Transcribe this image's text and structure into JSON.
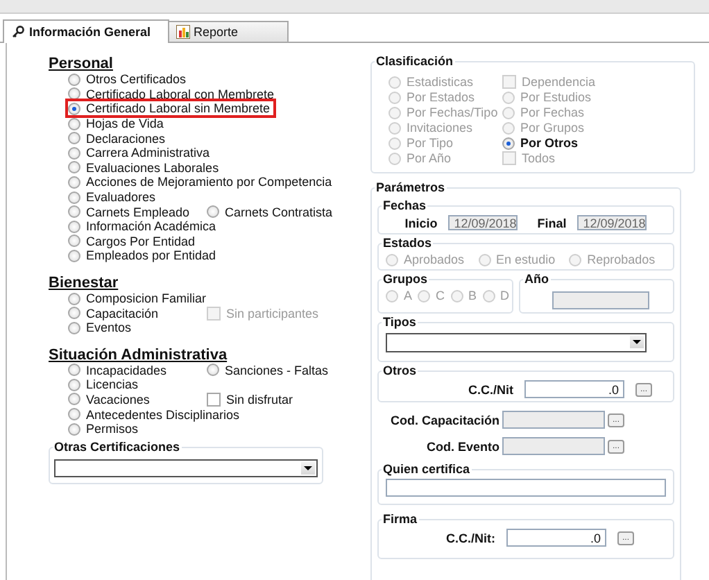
{
  "tabs": [
    {
      "label": "Información General",
      "selected": true,
      "kind": "gear"
    },
    {
      "label": "Reporte",
      "selected": false,
      "kind": "chart"
    }
  ],
  "left_sections": [
    {
      "title": "Personal",
      "rows": [
        [
          {
            "kind": "radio",
            "label": "Otros Certificados",
            "selected": false,
            "disabled": false,
            "highlighted": false
          }
        ],
        [
          {
            "kind": "radio",
            "label": "Certificado Laboral con Membrete",
            "selected": false,
            "disabled": false,
            "highlighted": false
          }
        ],
        [
          {
            "kind": "radio",
            "label": "Certificado Laboral sin Membrete",
            "selected": true,
            "disabled": false,
            "highlighted": true
          }
        ],
        [
          {
            "kind": "radio",
            "label": "Hojas de Vida",
            "selected": false,
            "disabled": false,
            "highlighted": false
          }
        ],
        [
          {
            "kind": "radio",
            "label": "Declaraciones",
            "selected": false,
            "disabled": false,
            "highlighted": false
          }
        ],
        [
          {
            "kind": "radio",
            "label": "Carrera Administrativa",
            "selected": false,
            "disabled": false,
            "highlighted": false
          }
        ],
        [
          {
            "kind": "radio",
            "label": "Evaluaciones Laborales",
            "selected": false,
            "disabled": false,
            "highlighted": false
          }
        ],
        [
          {
            "kind": "radio",
            "label": "Acciones de Mejoramiento por Competencia",
            "selected": false,
            "disabled": false,
            "highlighted": false
          }
        ],
        [
          {
            "kind": "radio",
            "label": "Evaluadores",
            "selected": false,
            "disabled": false,
            "highlighted": false
          }
        ],
        [
          {
            "kind": "radio",
            "label": "Carnets Empleado",
            "selected": false,
            "disabled": false,
            "highlighted": false
          },
          {
            "kind": "radio",
            "label": "Carnets Contratista",
            "selected": false,
            "disabled": false,
            "highlighted": false
          }
        ],
        [
          {
            "kind": "radio",
            "label": "Información Académica",
            "selected": false,
            "disabled": false,
            "highlighted": false
          }
        ],
        [
          {
            "kind": "radio",
            "label": "Cargos Por Entidad",
            "selected": false,
            "disabled": false,
            "highlighted": false
          }
        ],
        [
          {
            "kind": "radio",
            "label": "Empleados por Entidad",
            "selected": false,
            "disabled": false,
            "highlighted": false
          }
        ]
      ]
    },
    {
      "title": "Bienestar",
      "rows": [
        [
          {
            "kind": "radio",
            "label": "Composicion Familiar",
            "selected": false,
            "disabled": false,
            "highlighted": false
          }
        ],
        [
          {
            "kind": "radio",
            "label": "Capacitación",
            "selected": false,
            "disabled": false,
            "highlighted": false
          },
          {
            "kind": "checkbox",
            "label": "Sin participantes",
            "selected": false,
            "disabled": true,
            "highlighted": false
          }
        ],
        [
          {
            "kind": "radio",
            "label": "Eventos",
            "selected": false,
            "disabled": false,
            "highlighted": false
          }
        ]
      ]
    },
    {
      "title": "Situación Administrativa",
      "rows": [
        [
          {
            "kind": "radio",
            "label": "Incapacidades",
            "selected": false,
            "disabled": false,
            "highlighted": false
          },
          {
            "kind": "radio",
            "label": "Sanciones - Faltas",
            "selected": false,
            "disabled": false,
            "highlighted": false
          }
        ],
        [
          {
            "kind": "radio",
            "label": "Licencias",
            "selected": false,
            "disabled": false,
            "highlighted": false
          }
        ],
        [
          {
            "kind": "radio",
            "label": "Vacaciones",
            "selected": false,
            "disabled": false,
            "highlighted": false
          },
          {
            "kind": "checkbox",
            "label": "Sin disfrutar",
            "selected": false,
            "disabled": false,
            "highlighted": false
          }
        ],
        [
          {
            "kind": "radio",
            "label": "Antecedentes Disciplinarios",
            "selected": false,
            "disabled": false,
            "highlighted": false
          }
        ],
        [
          {
            "kind": "radio",
            "label": "Permisos",
            "selected": false,
            "disabled": false,
            "highlighted": false
          }
        ]
      ]
    }
  ],
  "otras_certificaciones": {
    "title": "Otras Certificaciones"
  },
  "clasificacion": {
    "title": "Clasificación",
    "items": [
      {
        "kind": "radio",
        "label": "Estadisticas",
        "selected": false,
        "disabled": true
      },
      {
        "kind": "checkbox",
        "label": "Dependencia",
        "selected": false,
        "disabled": true
      },
      {
        "kind": "radio",
        "label": "Por Estados",
        "selected": false,
        "disabled": true
      },
      {
        "kind": "radio",
        "label": "Por Estudios",
        "selected": false,
        "disabled": true
      },
      {
        "kind": "radio",
        "label": "Por Fechas/Tipo",
        "selected": false,
        "disabled": true
      },
      {
        "kind": "radio",
        "label": "Por Fechas",
        "selected": false,
        "disabled": true
      },
      {
        "kind": "radio",
        "label": "Invitaciones",
        "selected": false,
        "disabled": true
      },
      {
        "kind": "radio",
        "label": "Por Grupos",
        "selected": false,
        "disabled": true
      },
      {
        "kind": "radio",
        "label": "Por Tipo",
        "selected": false,
        "disabled": true
      },
      {
        "kind": "radio",
        "label": "Por Otros",
        "selected": true,
        "disabled": false
      },
      {
        "kind": "radio",
        "label": "Por Año",
        "selected": false,
        "disabled": true
      },
      {
        "kind": "checkbox",
        "label": "Todos",
        "selected": false,
        "disabled": true
      }
    ]
  },
  "parametros": {
    "title": "Parámetros",
    "fechas": {
      "title": "Fechas",
      "inicio_label": "Inicio",
      "inicio": "12/09/2018",
      "final_label": "Final",
      "final": "12/09/2018"
    },
    "estados": {
      "title": "Estados",
      "items": [
        {
          "kind": "radio",
          "label": "Aprobados",
          "selected": false,
          "disabled": true
        },
        {
          "kind": "radio",
          "label": "En estudio",
          "selected": false,
          "disabled": true
        },
        {
          "kind": "radio",
          "label": "Reprobados",
          "selected": false,
          "disabled": true
        }
      ]
    },
    "grupos": {
      "title": "Grupos",
      "items": [
        {
          "kind": "radio",
          "label": "A",
          "selected": false,
          "disabled": true
        },
        {
          "kind": "radio",
          "label": "C",
          "selected": false,
          "disabled": true
        },
        {
          "kind": "radio",
          "label": "B",
          "selected": false,
          "disabled": true
        },
        {
          "kind": "radio",
          "label": "D",
          "selected": false,
          "disabled": true
        }
      ]
    },
    "anio": {
      "title": "Año"
    },
    "tipos": {
      "title": "Tipos"
    },
    "otros": {
      "title": "Otros",
      "label": "C.C./Nit",
      "value": ".0",
      "button": "..."
    },
    "cod_capacitacion": {
      "label": "Cod. Capacitación",
      "button": "..."
    },
    "cod_evento": {
      "label": "Cod. Evento",
      "button": "..."
    },
    "quien_certifica": {
      "title": "Quien certifica"
    },
    "firma": {
      "title": "Firma",
      "label": "C.C./Nit:",
      "value": ".0",
      "button": "..."
    }
  }
}
